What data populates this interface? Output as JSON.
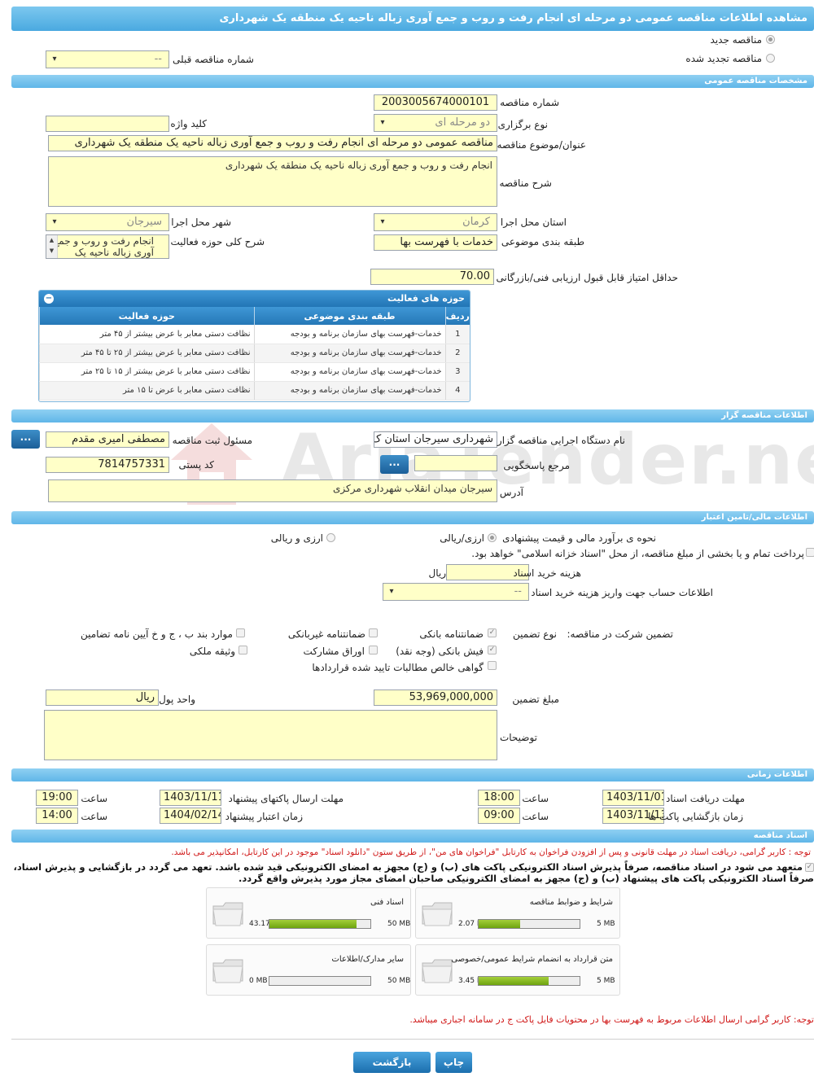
{
  "page": {
    "title": "مشاهده اطلاعات مناقصه عمومی دو مرحله ای انجام رفت و روب و جمع آوری زباله ناحیه یک منطقه یک شهرداری"
  },
  "tender_type": {
    "new_label": "مناقصه جدید",
    "renewed_label": "مناقصه تجدید شده",
    "prev_number_label": "شماره مناقصه قبلی",
    "prev_number_value": "--"
  },
  "general": {
    "header": "مشخصات مناقصه عمومی",
    "number_label": "شماره مناقصه",
    "number_value": "2003005674000101",
    "holding_type_label": "نوع برگزاری",
    "holding_type_value": "دو مرحله ای",
    "keyword_label": "کلید واژه",
    "keyword_value": "",
    "subject_label": "عنوان/موضوع مناقصه",
    "subject_value": "مناقصه عمومی دو مرحله ای انجام رفت و روب و جمع آوری زباله ناحیه یک منطقه یک شهرداری",
    "description_label": "شرح مناقصه",
    "description_value": "انجام رفت و روب و جمع آوری زباله ناحیه یک منطقه یک شهرداری",
    "province_label": "استان محل اجرا",
    "province_value": "کرمان",
    "city_label": "شهر محل اجرا",
    "city_value": "سیرجان",
    "category_label": "طبقه بندی موضوعی",
    "category_value": "خدمات با فهرست بها",
    "activity_desc_label": "شرح کلی حوزه فعالیت",
    "activity_desc_value": "انجام رفت و روب و جمع آوری زباله ناحیه یک منطقه",
    "min_score_label": "حداقل امتیاز قابل قبول ارزیابی فنی/بازرگانی",
    "min_score_value": "70.00"
  },
  "activity_grid": {
    "title": "حوزه های فعالیت",
    "columns": [
      "ردیف",
      "طبقه بندی موضوعی",
      "حوزه فعالیت"
    ],
    "rows": [
      {
        "n": "1",
        "category": "خدمات-فهرست بهای سازمان برنامه و بودجه",
        "scope": "نظافت دستی معابر با عرض بیشتر از ۴۵ متر"
      },
      {
        "n": "2",
        "category": "خدمات-فهرست بهای سازمان برنامه و بودجه",
        "scope": "نظافت دستی معابر با عرض بیشتر از ۲۵ تا ۴۵ متر"
      },
      {
        "n": "3",
        "category": "خدمات-فهرست بهای سازمان برنامه و بودجه",
        "scope": "نظافت دستی معابر با عرض بیشتر از ۱۵ تا ۲۵ متر"
      },
      {
        "n": "4",
        "category": "خدمات-فهرست بهای سازمان برنامه و بودجه",
        "scope": "نظافت دستی معابر با عرض تا ۱۵ متر"
      }
    ]
  },
  "organizer": {
    "header": "اطلاعات مناقصه گزار",
    "org_label": "نام دستگاه اجرایی مناقصه گزار",
    "org_value": "شهرداری سیرجان استان ک",
    "manager_label": "مسئول ثبت مناقصه",
    "manager_value": "مصطفی امیری مقدم",
    "ref_label": "مرجع پاسخگویی",
    "ref_value": "",
    "postal_label": "کد پستی",
    "postal_value": "7814757331",
    "address_label": "آدرس",
    "address_value": "سیرجان میدان انقلاب شهرداری مرکزی",
    "more_button": "...",
    "watermark": "AriaTender.neT"
  },
  "financial": {
    "header": "اطلاعات مالی/تامین اعتبار",
    "estimate_method_label": "نحوه ی برآورد مالی و قیمت پیشنهادی",
    "opt_rial": "ارزی/ریالی",
    "opt_fx_rial": "ارزی و ریالی",
    "treasury_text": "پرداخت تمام و یا بخشی از مبلغ مناقصه، از محل \"اسناد خزانه اسلامی\" خواهد بود.",
    "doc_cost_label": "هزینه خرید اسناد",
    "doc_cost_value": "",
    "doc_cost_unit": "ریال",
    "account_label": "اطلاعات حساب جهت واریز هزینه خرید اسناد",
    "account_value": "--",
    "guarantee_label": "تضمین شرکت در مناقصه:",
    "guarantee_type_label": "نوع تضمین",
    "g_bank": "ضمانتنامه بانکی",
    "g_nonbank": "ضمانتنامه غیربانکی",
    "g_rules": "موارد بند ب ، ج و خ آیین نامه تضامین",
    "g_cheque": "فیش بانکی (وجه نقد)",
    "g_bonds": "اوراق مشارکت",
    "g_property": "وثیقه ملکی",
    "g_receivables": "گواهی خالص مطالبات تایید شده قراردادها",
    "amount_label": "مبلغ تضمین",
    "amount_value": "53,969,000,000",
    "currency_label": "واحد پول",
    "currency_value": "ریال",
    "notes_label": "توضیحات",
    "notes_value": ""
  },
  "timing": {
    "header": "اطلاعات زمانی",
    "doc_receipt_label": "مهلت دریافت اسناد",
    "doc_receipt_date": "1403/11/01",
    "doc_receipt_time": "18:00",
    "submit_label": "مهلت ارسال پاکتهای پیشنهاد",
    "submit_date": "1403/11/11",
    "submit_time": "19:00",
    "open_label": "زمان بازگشایی پاکت ها",
    "open_date": "1403/11/13",
    "open_time": "09:00",
    "validity_label": "زمان اعتبار پیشنهاد",
    "validity_date": "1404/02/14",
    "validity_time": "14:00",
    "time_label": "ساعت"
  },
  "documents": {
    "header": "اسناد مناقصه",
    "note_red": "توجه : کاربر گرامی، دریافت اسناد در مهلت قانونی و پس از افزودن فراخوان به کارتابل \"فراخوان های من\"، از طریق ستون \"دانلود اسناد\" موجود در این کارتابل، امکانپذیر می باشد.",
    "bold_line1": "متعهد می شود در اسناد مناقصه، صرفاً پذیرش اسناد الکترونیکی پاکت های (ب) و (ج) مجهز به امضای الکترونیکی قید شده باشد. تعهد می گردد در بازگشایی و پذیرش اسناد،",
    "bold_line2": "صرفاً اسناد الکترونیکی پاکت های پیشنهاد (ب) و (ج) مجهز به امضای الکترونیکی صاحبان امضای مجاز مورد پذیرش واقع گردد.",
    "files": [
      {
        "name": "شرایط و ضوابط مناقصه",
        "used": "2.07 MB",
        "max": "5 MB",
        "ratio": 0.414
      },
      {
        "name": "اسناد فنی",
        "used": "43.17 MB",
        "max": "50 MB",
        "ratio": 0.863
      },
      {
        "name": "متن قرارداد به انضمام شرایط عمومی/خصوصی",
        "used": "3.45 MB",
        "max": "5 MB",
        "ratio": 0.69
      },
      {
        "name": "سایر مدارک/اطلاعات",
        "used": "0 MB",
        "max": "50 MB",
        "ratio": 0.0
      }
    ],
    "note_bottom": "توجه: کاربر گرامی ارسال اطلاعات مربوط به فهرست بها در محتویات فایل پاکت ج در سامانه اجباری میباشد."
  },
  "actions": {
    "print": "چاپ",
    "back": "بازگشت"
  },
  "colors": {
    "header_blue": "#5fb6e8",
    "field_yellow": "#ffffc8",
    "note_red": "#d01818",
    "progress_green": "#7fb41f"
  }
}
